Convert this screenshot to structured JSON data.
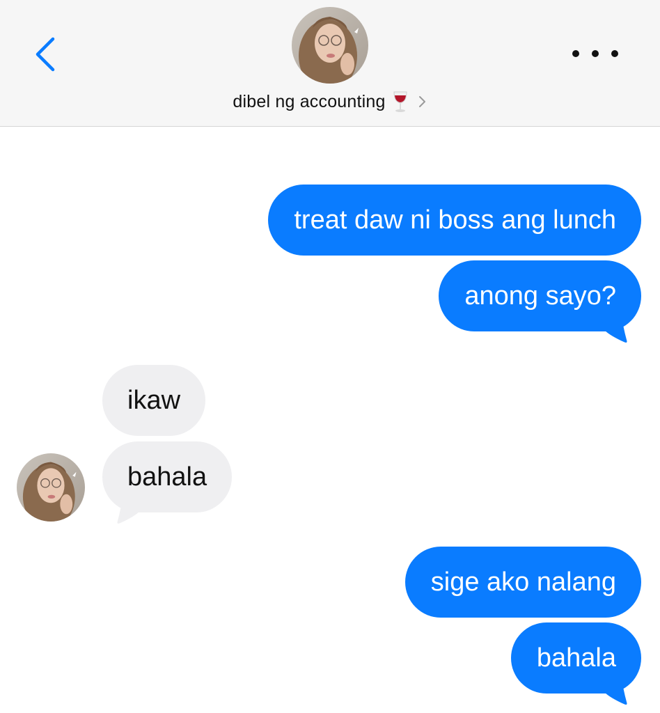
{
  "header": {
    "contact_name": "dibel ng accounting",
    "name_emoji_icon": "wine-glass-icon",
    "back_icon": "chevron-left-icon",
    "more_icon": "more-dots-icon"
  },
  "colors": {
    "accent": "#0a7cff",
    "incoming_bubble": "#efeff1",
    "header_bg": "#f6f6f6"
  },
  "messages": [
    {
      "direction": "out",
      "text": "treat daw ni boss ang lunch"
    },
    {
      "direction": "out",
      "text": "anong sayo?"
    },
    {
      "direction": "in",
      "text": "ikaw"
    },
    {
      "direction": "in",
      "text": "bahala"
    },
    {
      "direction": "out",
      "text": "sige ako nalang"
    },
    {
      "direction": "out",
      "text": "bahala"
    }
  ]
}
